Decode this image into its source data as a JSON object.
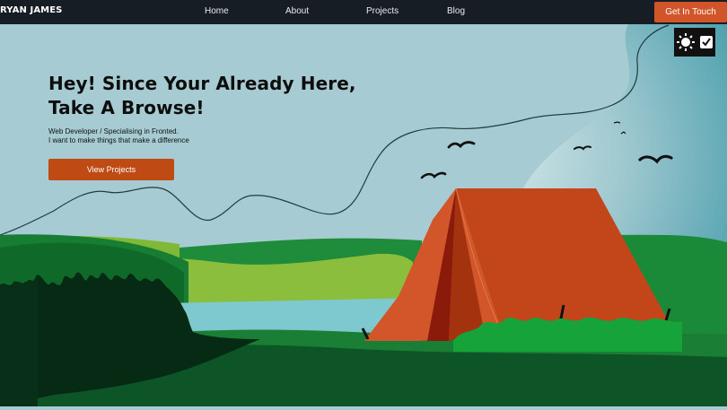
{
  "nav": {
    "brand": "RYAN JAMES",
    "links": [
      "Home",
      "About",
      "Projects",
      "Blog"
    ],
    "cta_label": "Get In Touch"
  },
  "hero": {
    "title_line1": "Hey! Since Your Already Here,",
    "title_line2": "Take A Browse!",
    "subtitle_line1": "Web Developer / Specialising in Fronted.",
    "subtitle_line2": "I want to make things that make a difference",
    "button_label": "View Projects"
  },
  "toggle": {
    "icons": [
      "sun-icon",
      "checkbox-checked-icon"
    ]
  },
  "colors": {
    "nav_bg": "#161d24",
    "accent": "#d2552a",
    "button": "#c04a14",
    "sky": "#a7cbd2",
    "tent": "#c2461a"
  }
}
